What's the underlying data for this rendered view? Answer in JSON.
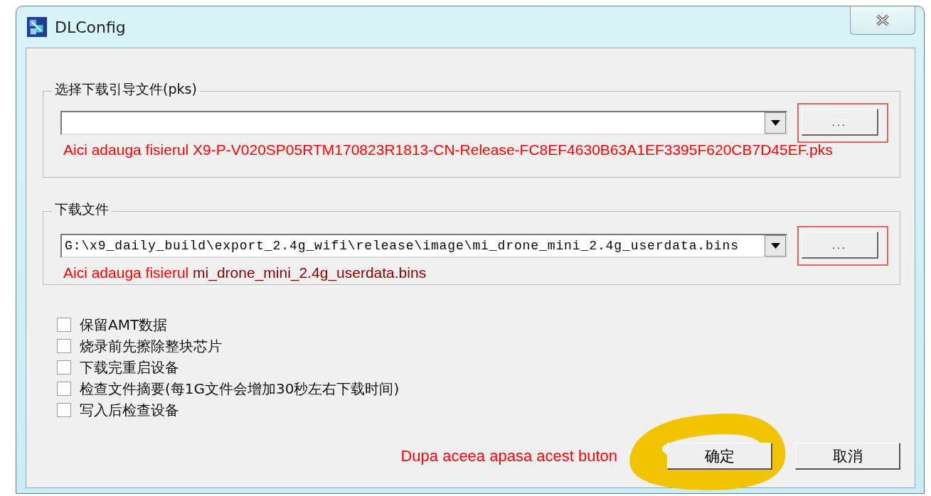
{
  "window": {
    "title": "DLConfig"
  },
  "groups": [
    {
      "title": "选择下载引导文件(pks)",
      "browse_label": "...",
      "highlighted": true,
      "note": [
        {
          "text": "Aici adauga fisierul X9-P-V020SP05RTM170823R1813-CN-Release-FC8EF4630B63A1EF3395F620CB7D45EF.pks",
          "color": "#ff0000"
        }
      ]
    },
    {
      "title": "下载文件",
      "combo_value": "G:\\x9_daily_build\\export_2.4g_wifi\\release\\image\\mi_drone_mini_2.4g_userdata.bins",
      "browse_label": "...",
      "highlighted": true,
      "note": [
        {
          "text": "Aici adauga fisierul",
          "color": "#ff0000"
        },
        {
          "text": "mi_drone_mini_2.4g_userdata.bins",
          "color": "#8b0000"
        }
      ]
    }
  ],
  "options": [
    {
      "label": "保留AMT数据",
      "checked": false
    },
    {
      "label": "烧录前先擦除整块芯片",
      "checked": false
    },
    {
      "label": "下载完重启设备",
      "checked": false
    },
    {
      "label": "检查文件摘要(每1G文件会增加30秒左右下载时间)",
      "checked": false
    },
    {
      "label": "写入后检查设备",
      "checked": false
    }
  ],
  "footer_note": "Dupa aceea apasa acest buton",
  "buttons": [
    {
      "label": "确定",
      "circled": true
    },
    {
      "label": "取消",
      "circled": false
    }
  ]
}
